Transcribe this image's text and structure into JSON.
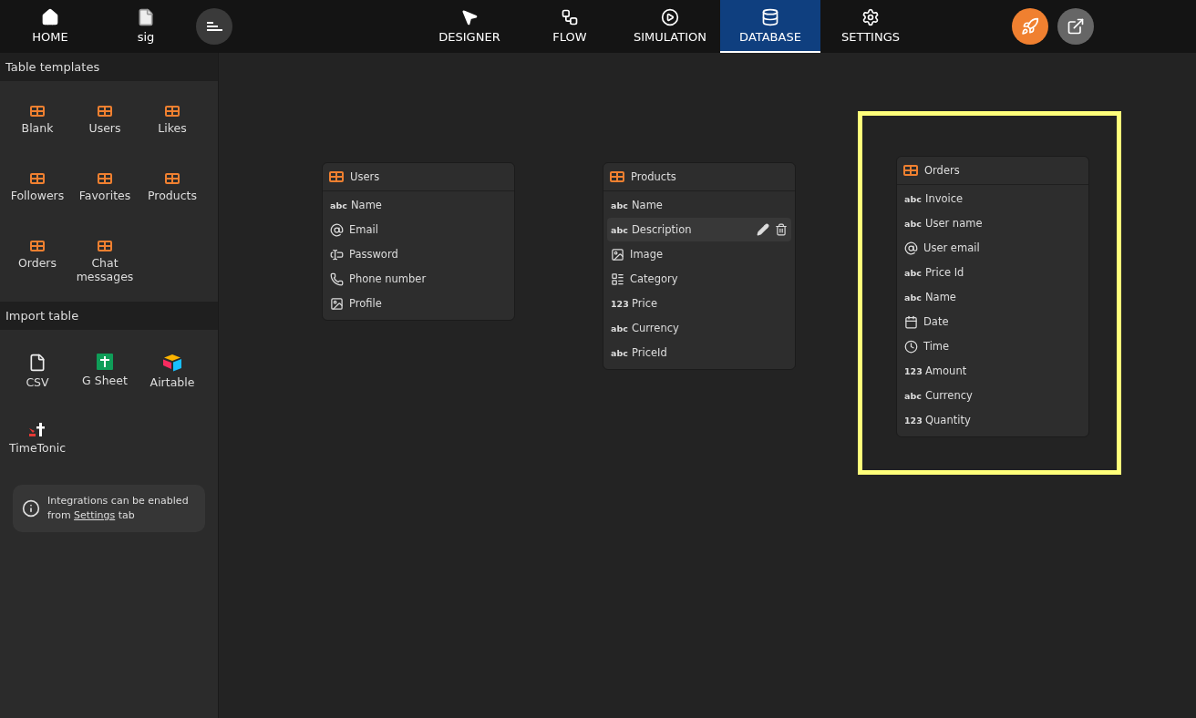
{
  "topbar": {
    "left": [
      {
        "kind": "home",
        "label": "HOME"
      },
      {
        "kind": "file",
        "label": "sig"
      }
    ],
    "tabs": [
      {
        "kind": "designer",
        "label": "DESIGNER",
        "selected": false
      },
      {
        "kind": "flow",
        "label": "FLOW",
        "selected": false
      },
      {
        "kind": "simulation",
        "label": "SIMULATION",
        "selected": false
      },
      {
        "kind": "database",
        "label": "DATABASE",
        "selected": true
      },
      {
        "kind": "settings",
        "label": "SETTINGS",
        "selected": false
      }
    ]
  },
  "sidebar": {
    "templates_title": "Table templates",
    "templates": [
      "Blank",
      "Users",
      "Likes",
      "Followers",
      "Favorites",
      "Products",
      "Orders",
      "Chat messages"
    ],
    "import_title": "Import table",
    "imports": [
      {
        "kind": "csv",
        "label": "CSV"
      },
      {
        "kind": "gsheet",
        "label": "G Sheet"
      },
      {
        "kind": "airtable",
        "label": "Airtable"
      },
      {
        "kind": "timetonic",
        "label": "TimeTonic"
      }
    ],
    "note": {
      "before": "Integrations can be enabled from",
      "link": "Settings",
      "after": "tab"
    }
  },
  "tables": [
    {
      "name": "Users",
      "highlighted": false,
      "fields": [
        {
          "kind": "text",
          "badge": "abc",
          "name": "Name",
          "hovered": false
        },
        {
          "kind": "email",
          "name": "Email",
          "hovered": false
        },
        {
          "kind": "password",
          "name": "Password",
          "hovered": false
        },
        {
          "kind": "phone",
          "name": "Phone number",
          "hovered": false
        },
        {
          "kind": "image",
          "name": "Profile",
          "hovered": false
        }
      ]
    },
    {
      "name": "Products",
      "highlighted": false,
      "fields": [
        {
          "kind": "text",
          "badge": "abc",
          "name": "Name",
          "hovered": false
        },
        {
          "kind": "text",
          "badge": "abc",
          "name": "Description",
          "hovered": true
        },
        {
          "kind": "image",
          "name": "Image",
          "hovered": false
        },
        {
          "kind": "category",
          "name": "Category",
          "hovered": false
        },
        {
          "kind": "number",
          "badge": "123",
          "name": "Price",
          "hovered": false
        },
        {
          "kind": "text",
          "badge": "abc",
          "name": "Currency",
          "hovered": false
        },
        {
          "kind": "text",
          "badge": "abc",
          "name": "PriceId",
          "hovered": false
        }
      ]
    },
    {
      "name": "Orders",
      "highlighted": true,
      "fields": [
        {
          "kind": "text",
          "badge": "abc",
          "name": "Invoice",
          "hovered": false
        },
        {
          "kind": "text",
          "badge": "abc",
          "name": "User name",
          "hovered": false
        },
        {
          "kind": "email",
          "name": "User email",
          "hovered": false
        },
        {
          "kind": "text",
          "badge": "abc",
          "name": "Price Id",
          "hovered": false
        },
        {
          "kind": "text",
          "badge": "abc",
          "name": "Name",
          "hovered": false
        },
        {
          "kind": "date",
          "name": "Date",
          "hovered": false
        },
        {
          "kind": "time",
          "name": "Time",
          "hovered": false
        },
        {
          "kind": "number",
          "badge": "123",
          "name": "Amount",
          "hovered": false
        },
        {
          "kind": "text",
          "badge": "abc",
          "name": "Currency",
          "hovered": false
        },
        {
          "kind": "number",
          "badge": "123",
          "name": "Quantity",
          "hovered": false
        }
      ]
    }
  ]
}
